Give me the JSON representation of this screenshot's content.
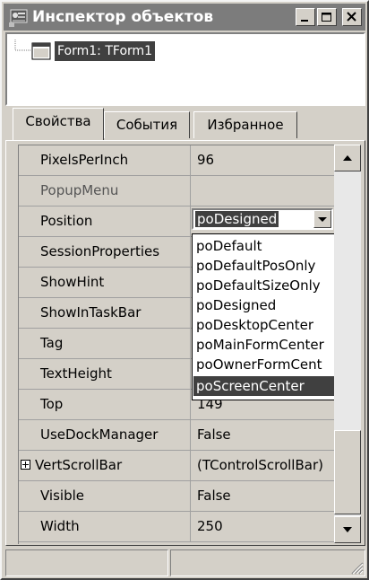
{
  "window": {
    "title": "Инспектор объектов",
    "controls": [
      "minimize-icon",
      "maximize-icon",
      "close-icon"
    ]
  },
  "tree": {
    "selected_node": "Form1: TForm1"
  },
  "tabs": [
    {
      "label": "Свойства",
      "active": true
    },
    {
      "label": "События",
      "active": false
    },
    {
      "label": "Избранное",
      "active": false
    }
  ],
  "properties": [
    {
      "name": "PixelsPerInch",
      "value": "96"
    },
    {
      "name": "PopupMenu",
      "value": ""
    },
    {
      "name": "Position",
      "value": "poDesigned"
    },
    {
      "name": "SessionProperties",
      "value": ""
    },
    {
      "name": "ShowHint",
      "value": ""
    },
    {
      "name": "ShowInTaskBar",
      "value": ""
    },
    {
      "name": "Tag",
      "value": ""
    },
    {
      "name": "TextHeight",
      "value": ""
    },
    {
      "name": "Top",
      "value": "149"
    },
    {
      "name": "UseDockManager",
      "value": "False"
    },
    {
      "name": "VertScrollBar",
      "value": "(TControlScrollBar)",
      "expandable": true
    },
    {
      "name": "Visible",
      "value": "False"
    },
    {
      "name": "Width",
      "value": "250"
    }
  ],
  "position_combo": {
    "value": "poDesigned",
    "options": [
      "poDefault",
      "poDefaultPosOnly",
      "poDefaultSizeOnly",
      "poDesigned",
      "poDesktopCenter",
      "poMainFormCenter",
      "poOwnerFormCent",
      "poScreenCenter"
    ],
    "highlighted": "poScreenCenter"
  },
  "statusbar": {
    "left": "",
    "right": ""
  },
  "colors": {
    "face": "#d4d0c8",
    "titlebar": "#7c7c7c",
    "highlight": "#404040"
  }
}
